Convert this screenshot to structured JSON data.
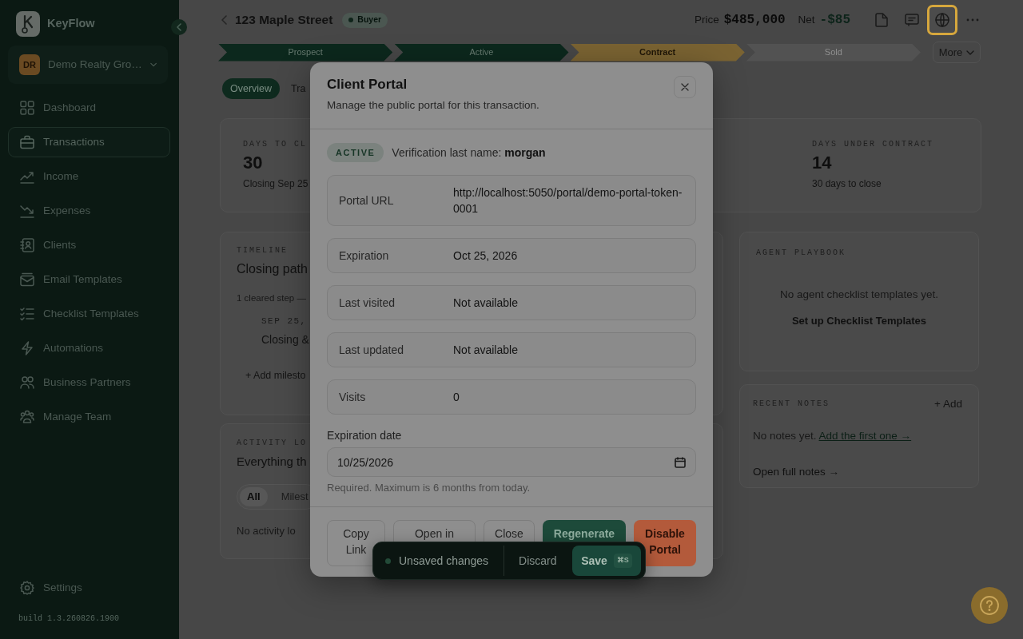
{
  "sidebar": {
    "brand": "KeyFlow",
    "org": {
      "initials": "DR",
      "name": "Demo Realty Gro…"
    },
    "nav": [
      {
        "label": "Dashboard",
        "selected": false
      },
      {
        "label": "Transactions",
        "selected": true
      },
      {
        "label": "Income",
        "selected": false
      },
      {
        "label": "Expenses",
        "selected": false
      },
      {
        "label": "Clients",
        "selected": false
      },
      {
        "label": "Email Templates",
        "selected": false
      },
      {
        "label": "Checklist Templates",
        "selected": false
      },
      {
        "label": "Automations",
        "selected": false
      },
      {
        "label": "Business Partners",
        "selected": false
      },
      {
        "label": "Manage Team",
        "selected": false
      }
    ],
    "settings": "Settings",
    "build": "build 1.3.260826.1900"
  },
  "header": {
    "title": "123 Maple Street",
    "badge": "Buyer",
    "price_label": "Price",
    "price": "$485,000",
    "net_label": "Net",
    "net": "-$85",
    "actions": [
      {
        "selected": false
      },
      {
        "selected": false
      },
      {
        "selected": true
      },
      {
        "selected": false
      }
    ]
  },
  "pipeline": {
    "stages": [
      {
        "label": "Prospect",
        "completed": true,
        "current": false
      },
      {
        "label": "Active",
        "completed": true,
        "current": false
      },
      {
        "label": "Contract",
        "completed": false,
        "current": true
      },
      {
        "label": "Sold",
        "completed": false,
        "current": false
      }
    ],
    "more": "More"
  },
  "tabs": [
    {
      "label": "Overview",
      "selected": true
    },
    {
      "label": "Tra",
      "selected": false
    }
  ],
  "stats": [
    {
      "label": "DAYS TO CL",
      "value": "30",
      "note": "Closing Sep 25"
    },
    {
      "label": "DAYS UNDER CONTRACT",
      "value": "14",
      "note": "30 days to close"
    }
  ],
  "timeline": {
    "heading": "TIMELINE",
    "title": "Closing path",
    "summary": "1 cleared step —",
    "milestones": [
      {
        "date": "SEP 25,",
        "title": "Closing &"
      }
    ],
    "add": "+ Add milesto"
  },
  "activity": {
    "heading": "ACTIVITY LO",
    "title": "Everything th",
    "filters": [
      {
        "label": "All",
        "selected": true
      },
      {
        "label": "Milest",
        "selected": false
      }
    ],
    "empty": "No activity lo"
  },
  "playbook": {
    "heading": "AGENT PLAYBOOK",
    "empty": "No agent checklist templates yet.",
    "action": "Set up Checklist Templates"
  },
  "notes": {
    "heading": "RECENT NOTES",
    "add": "+ Add",
    "empty": "No notes yet.",
    "link": "Add the first one →",
    "open": "Open full notes →"
  },
  "modal": {
    "title": "Client Portal",
    "subtitle": "Manage the public portal for this transaction.",
    "status": "ACTIVE",
    "verification": "Verification last name: **morgan**",
    "fields": [
      {
        "label": "Portal URL",
        "value": "http://localhost:5050/portal/demo-portal-token-0001"
      },
      {
        "label": "Expiration",
        "value": "Oct 25, 2026"
      },
      {
        "label": "Last visited",
        "value": "Not available"
      },
      {
        "label": "Last updated",
        "value": "Not available"
      },
      {
        "label": "Visits",
        "value": "0"
      }
    ],
    "date_field": {
      "label": "Expiration date",
      "value": "10/25/2026"
    },
    "hint": "Required. Maximum is 6 months from today.",
    "buttons": [
      {
        "label": "Copy Link",
        "kind": "secondary"
      },
      {
        "label": "Open in",
        "kind": "secondary"
      },
      {
        "label": "Close",
        "kind": "secondary"
      },
      {
        "label": "Regenerate",
        "kind": "primary"
      },
      {
        "label": "Disable Portal",
        "kind": "danger"
      }
    ]
  },
  "unsaved_bar": {
    "status": "Unsaved changes",
    "discard": "Discard",
    "save": "Save",
    "shortcut": "⌘S"
  }
}
